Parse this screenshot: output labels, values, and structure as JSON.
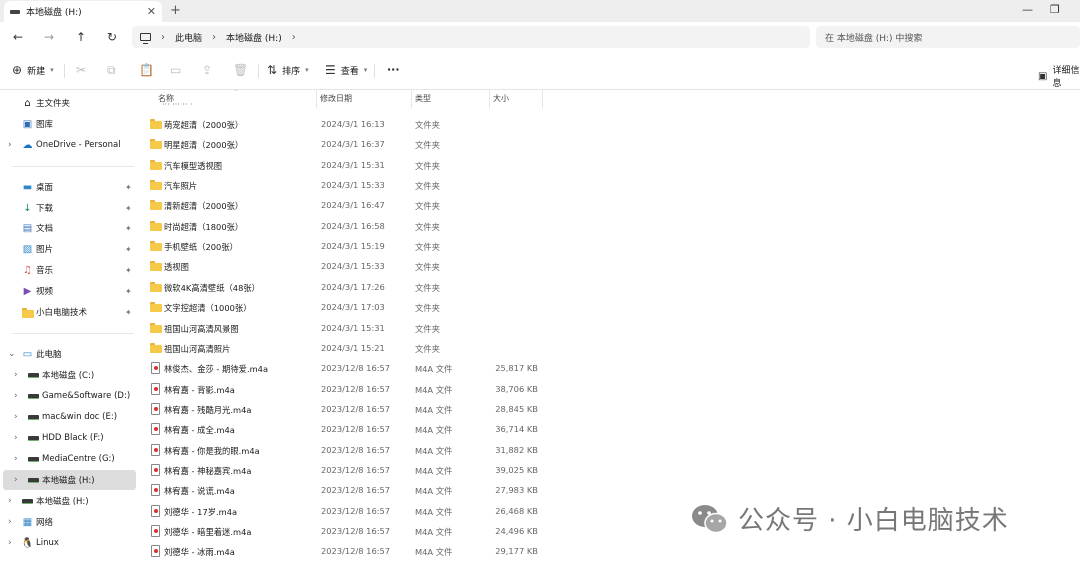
{
  "tabs": {
    "active_title": "本地磁盘 (H:)",
    "close_glyph": "✕",
    "new_tab_glyph": "+"
  },
  "window_controls": {
    "minimize": "—",
    "maximize": "❐"
  },
  "nav": {
    "back": "←",
    "forward": "→",
    "up": "↑",
    "refresh": "↻"
  },
  "breadcrumb": {
    "items": [
      "此电脑",
      "本地磁盘 (H:)"
    ],
    "separator": "›"
  },
  "search": {
    "placeholder": "在 本地磁盘 (H:) 中搜索"
  },
  "toolbar": {
    "new_label": "新建",
    "sort_label": "排序",
    "view_label": "查看",
    "more_label": "···",
    "details_label": "详细信息"
  },
  "sidebar": {
    "quick": [
      {
        "label": "主文件夹",
        "icon": "home-icon"
      },
      {
        "label": "图库",
        "icon": "gallery-icon"
      },
      {
        "label": "OneDrive - Personal",
        "icon": "cloud-icon"
      }
    ],
    "pinned": [
      {
        "label": "桌面",
        "icon": "desktop-icon"
      },
      {
        "label": "下载",
        "icon": "download-icon"
      },
      {
        "label": "文档",
        "icon": "document-icon"
      },
      {
        "label": "图片",
        "icon": "pictures-icon"
      },
      {
        "label": "音乐",
        "icon": "music-icon"
      },
      {
        "label": "视频",
        "icon": "video-icon"
      },
      {
        "label": "小白电脑技术",
        "icon": "folder-icon"
      }
    ],
    "this_pc_label": "此电脑",
    "drives": [
      {
        "label": "本地磁盘 (C:)"
      },
      {
        "label": "Game&Software (D:)"
      },
      {
        "label": "mac&win doc (E:)"
      },
      {
        "label": "HDD Black (F:)"
      },
      {
        "label": "MediaCentre (G:)"
      },
      {
        "label": "本地磁盘 (H:)"
      }
    ],
    "bottom": [
      {
        "label": "本地磁盘 (H:)",
        "icon": "drive-icon"
      },
      {
        "label": "网络",
        "icon": "network-icon"
      },
      {
        "label": "Linux",
        "icon": "linux-icon"
      }
    ],
    "pin_glyph": "📌"
  },
  "columns": {
    "name": "名称",
    "date": "修改日期",
    "type": "类型",
    "size": "大小"
  },
  "partial_top_row": "··· ··· ·· ·",
  "files": [
    {
      "name": "萌宠超清（2000张）",
      "date": "2024/3/1 16:13",
      "type": "文件夹",
      "size": "",
      "kind": "folder"
    },
    {
      "name": "明星超清（2000张）",
      "date": "2024/3/1 16:37",
      "type": "文件夹",
      "size": "",
      "kind": "folder"
    },
    {
      "name": "汽车模型透视图",
      "date": "2024/3/1 15:31",
      "type": "文件夹",
      "size": "",
      "kind": "folder"
    },
    {
      "name": "汽车照片",
      "date": "2024/3/1 15:33",
      "type": "文件夹",
      "size": "",
      "kind": "folder"
    },
    {
      "name": "清新超清（2000张）",
      "date": "2024/3/1 16:47",
      "type": "文件夹",
      "size": "",
      "kind": "folder"
    },
    {
      "name": "时尚超清（1800张）",
      "date": "2024/3/1 16:58",
      "type": "文件夹",
      "size": "",
      "kind": "folder"
    },
    {
      "name": "手机壁纸（200张）",
      "date": "2024/3/1 15:19",
      "type": "文件夹",
      "size": "",
      "kind": "folder"
    },
    {
      "name": "透视图",
      "date": "2024/3/1 15:33",
      "type": "文件夹",
      "size": "",
      "kind": "folder"
    },
    {
      "name": "微软4K高清壁纸（48张）",
      "date": "2024/3/1 17:26",
      "type": "文件夹",
      "size": "",
      "kind": "folder"
    },
    {
      "name": "文字控超清（1000张）",
      "date": "2024/3/1 17:03",
      "type": "文件夹",
      "size": "",
      "kind": "folder"
    },
    {
      "name": "祖国山河高清风景图",
      "date": "2024/3/1 15:31",
      "type": "文件夹",
      "size": "",
      "kind": "folder"
    },
    {
      "name": "祖国山河高清照片",
      "date": "2024/3/1 15:21",
      "type": "文件夹",
      "size": "",
      "kind": "folder"
    },
    {
      "name": "林俊杰、金莎 - 期待爱.m4a",
      "date": "2023/12/8 16:57",
      "type": "M4A 文件",
      "size": "25,817 KB",
      "kind": "m4a"
    },
    {
      "name": "林宥嘉 - 背影.m4a",
      "date": "2023/12/8 16:57",
      "type": "M4A 文件",
      "size": "38,706 KB",
      "kind": "m4a"
    },
    {
      "name": "林宥嘉 - 残酷月光.m4a",
      "date": "2023/12/8 16:57",
      "type": "M4A 文件",
      "size": "28,845 KB",
      "kind": "m4a"
    },
    {
      "name": "林宥嘉 - 成全.m4a",
      "date": "2023/12/8 16:57",
      "type": "M4A 文件",
      "size": "36,714 KB",
      "kind": "m4a"
    },
    {
      "name": "林宥嘉 - 你是我的眼.m4a",
      "date": "2023/12/8 16:57",
      "type": "M4A 文件",
      "size": "31,882 KB",
      "kind": "m4a"
    },
    {
      "name": "林宥嘉 - 神秘嘉宾.m4a",
      "date": "2023/12/8 16:57",
      "type": "M4A 文件",
      "size": "39,025 KB",
      "kind": "m4a"
    },
    {
      "name": "林宥嘉 - 说谎.m4a",
      "date": "2023/12/8 16:57",
      "type": "M4A 文件",
      "size": "27,983 KB",
      "kind": "m4a"
    },
    {
      "name": "刘德华 - 17岁.m4a",
      "date": "2023/12/8 16:57",
      "type": "M4A 文件",
      "size": "26,468 KB",
      "kind": "m4a"
    },
    {
      "name": "刘德华 - 暗里着迷.m4a",
      "date": "2023/12/8 16:57",
      "type": "M4A 文件",
      "size": "24,496 KB",
      "kind": "m4a"
    },
    {
      "name": "刘德华 - 冰雨.m4a",
      "date": "2023/12/8 16:57",
      "type": "M4A 文件",
      "size": "29,177 KB",
      "kind": "m4a"
    }
  ],
  "watermark": {
    "text": "公众号 · 小白电脑技术"
  },
  "colors": {
    "folder": "#f7c948",
    "selected": "#dcdcdc",
    "onedrive": "#1a73c9"
  }
}
